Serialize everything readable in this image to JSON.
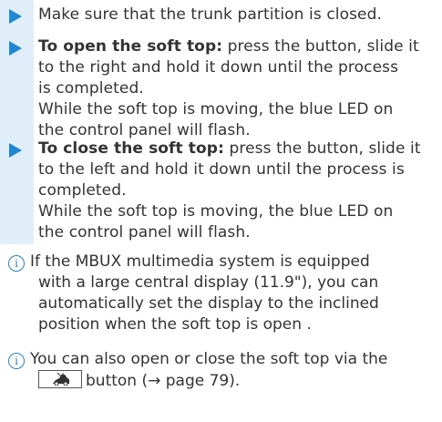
{
  "steps": [
    {
      "lines": [
        "Make sure that the trunk partition is closed."
      ]
    },
    {
      "bold": "To open the soft top:",
      "rest": " press the button, slide it",
      "lines": [
        "to the right and hold it down until the process",
        "is completed.",
        "While the soft top is moving, the blue LED on",
        "the control panel will flash."
      ]
    },
    {
      "bold": "To close the soft top:",
      "rest": " press the button, slide it",
      "lines": [
        "to the left and hold it down until the process is",
        "completed.",
        "While the soft top is moving, the blue LED on",
        "the control panel will flash."
      ]
    }
  ],
  "notes": [
    {
      "lines": [
        "If the MBUX multimedia system is equipped",
        "with a large central display (11.9\"), you can",
        "automatically set the display to the inclined",
        "position when the soft top is open ."
      ]
    },
    {
      "lines": [
        "You can also open or close the soft top via the"
      ],
      "button_suffix": "button (→ page 79)."
    }
  ],
  "icons": {
    "step_marker": "triangle-right-icon",
    "note_marker": "info-icon",
    "inline_button": "convertible-roof-icon"
  },
  "colors": {
    "accent_blue": "#1e88d4",
    "band": "#dfeef9",
    "info_blue": "#2a7fc2",
    "text": "#333333"
  }
}
